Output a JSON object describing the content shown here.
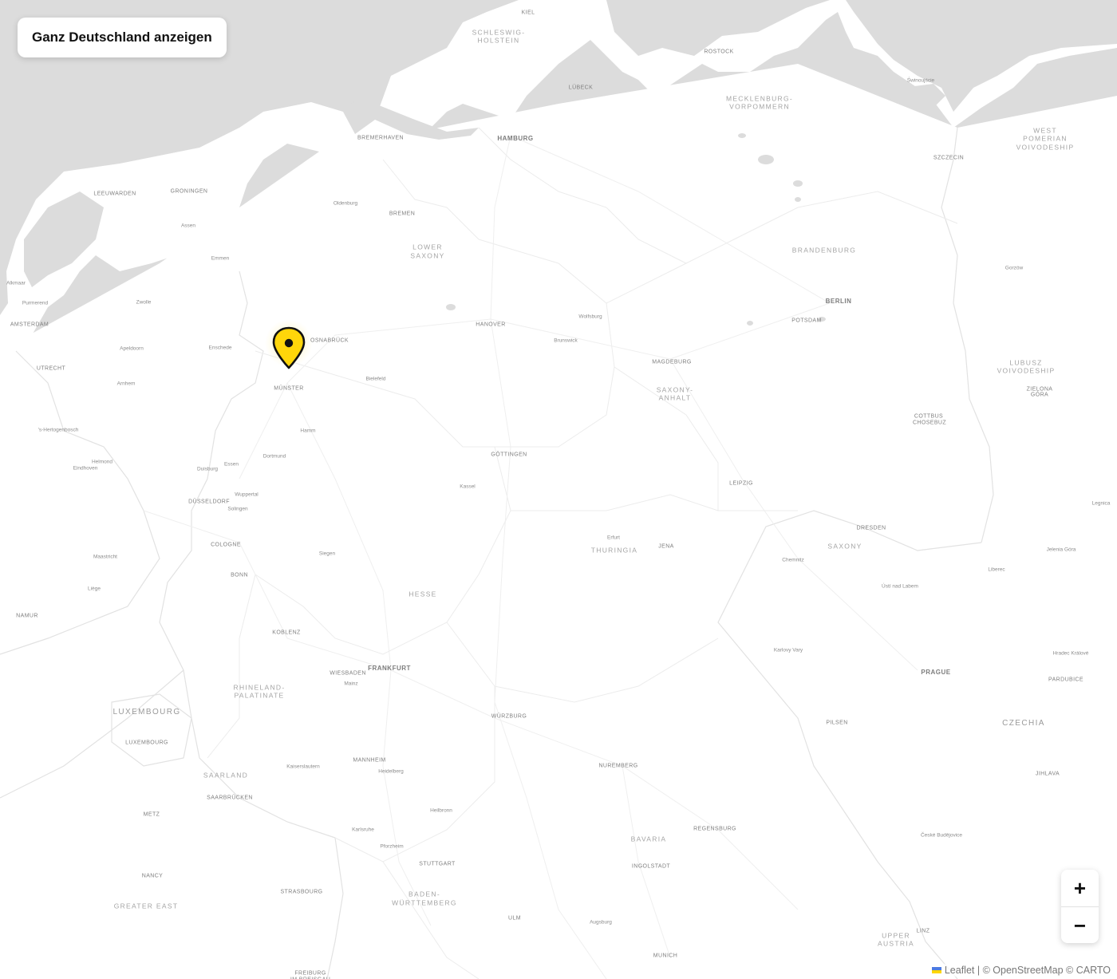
{
  "controls": {
    "reset_label": "Ganz Deutschland anzeigen",
    "zoom_in": "+",
    "zoom_out": "−"
  },
  "attribution": {
    "leaflet": "Leaflet",
    "sep": "|",
    "osm": "© OpenStreetMap",
    "carto": "© CARTO"
  },
  "marker": {
    "color": "#FFD60A",
    "outline": "#111111"
  },
  "colors": {
    "land": "#ffffff",
    "water": "#d9d9d9",
    "border": "#e4e4e4"
  },
  "labels": [
    {
      "t": "KIEL",
      "c": "city"
    },
    {
      "t": "SCHLESWIG-",
      "c": "region"
    },
    {
      "t": "HOLSTEIN",
      "c": "region"
    },
    {
      "t": "ROSTOCK",
      "c": "city"
    },
    {
      "t": "LÜBECK",
      "c": "city"
    },
    {
      "t": "MECKLENBURG-",
      "c": "region"
    },
    {
      "t": "VORPOMMERN",
      "c": "region"
    },
    {
      "t": "Świnoujście",
      "c": "town"
    },
    {
      "t": "WEST",
      "c": "region"
    },
    {
      "t": "POMERIAN",
      "c": "region"
    },
    {
      "t": "VOIVODESHIP",
      "c": "region"
    },
    {
      "t": "SZCZECIN",
      "c": "city"
    },
    {
      "t": "BREMERHAVEN",
      "c": "city"
    },
    {
      "t": "HAMBURG",
      "c": "major"
    },
    {
      "t": "LEEUWARDEN",
      "c": "city"
    },
    {
      "t": "GRONINGEN",
      "c": "city"
    },
    {
      "t": "Oldenburg",
      "c": "town"
    },
    {
      "t": "BREMEN",
      "c": "city"
    },
    {
      "t": "Assen",
      "c": "town"
    },
    {
      "t": "LOWER",
      "c": "region"
    },
    {
      "t": "SAXONY",
      "c": "region"
    },
    {
      "t": "BRANDENBURG",
      "c": "region"
    },
    {
      "t": "Emmen",
      "c": "town"
    },
    {
      "t": "Gorzów",
      "c": "town"
    },
    {
      "t": "Alkmaar",
      "c": "town"
    },
    {
      "t": "Purmerend",
      "c": "town"
    },
    {
      "t": "Zwolle",
      "c": "town"
    },
    {
      "t": "BERLIN",
      "c": "major"
    },
    {
      "t": "Wolfsburg",
      "c": "town"
    },
    {
      "t": "AMSTERDAM",
      "c": "city"
    },
    {
      "t": "HANOVER",
      "c": "city"
    },
    {
      "t": "POTSDAM",
      "c": "city"
    },
    {
      "t": "OSNABRÜCK",
      "c": "city"
    },
    {
      "t": "Enschede",
      "c": "town"
    },
    {
      "t": "Apeldoorn",
      "c": "town"
    },
    {
      "t": "Brunswick",
      "c": "town"
    },
    {
      "t": "MAGDEBURG",
      "c": "city"
    },
    {
      "t": "LUBUSZ",
      "c": "region"
    },
    {
      "t": "VOIVODESHIP",
      "c": "region"
    },
    {
      "t": "UTRECHT",
      "c": "city"
    },
    {
      "t": "Bielefeld",
      "c": "town"
    },
    {
      "t": "Arnhem",
      "c": "town"
    },
    {
      "t": "MÜNSTER",
      "c": "city"
    },
    {
      "t": "SAXONY-",
      "c": "region"
    },
    {
      "t": "ANHALT",
      "c": "region"
    },
    {
      "t": "ZIELONA",
      "c": "city"
    },
    {
      "t": "GÓRA",
      "c": "city"
    },
    {
      "t": "COTTBUS",
      "c": "city"
    },
    {
      "t": "CHOSEBUZ",
      "c": "city"
    },
    {
      "t": "'s-Hertogenbosch",
      "c": "town"
    },
    {
      "t": "Hamm",
      "c": "town"
    },
    {
      "t": "GÖTTINGEN",
      "c": "city"
    },
    {
      "t": "Dortmund",
      "c": "town"
    },
    {
      "t": "Helmond",
      "c": "town"
    },
    {
      "t": "Eindhoven",
      "c": "town"
    },
    {
      "t": "Essen",
      "c": "town"
    },
    {
      "t": "Duisburg",
      "c": "town"
    },
    {
      "t": "Kassel",
      "c": "town"
    },
    {
      "t": "LEIPZIG",
      "c": "city"
    },
    {
      "t": "Wuppertal",
      "c": "town"
    },
    {
      "t": "DÜSSELDORF",
      "c": "city"
    },
    {
      "t": "Solingen",
      "c": "town"
    },
    {
      "t": "Legnica",
      "c": "town"
    },
    {
      "t": "DRESDEN",
      "c": "city"
    },
    {
      "t": "Erfurt",
      "c": "town"
    },
    {
      "t": "COLOGNE",
      "c": "city"
    },
    {
      "t": "THURINGIA",
      "c": "region"
    },
    {
      "t": "JENA",
      "c": "city"
    },
    {
      "t": "SAXONY",
      "c": "region"
    },
    {
      "t": "Siegen",
      "c": "town"
    },
    {
      "t": "Jelenia Góra",
      "c": "town"
    },
    {
      "t": "Maastricht",
      "c": "town"
    },
    {
      "t": "Chemnitz",
      "c": "town"
    },
    {
      "t": "BONN",
      "c": "city"
    },
    {
      "t": "Liberec",
      "c": "town"
    },
    {
      "t": "Liège",
      "c": "town"
    },
    {
      "t": "Ústí nad Labem",
      "c": "town"
    },
    {
      "t": "HESSE",
      "c": "region"
    },
    {
      "t": "NAMUR",
      "c": "city"
    },
    {
      "t": "KOBLENZ",
      "c": "city"
    },
    {
      "t": "Karlovy Vary",
      "c": "town"
    },
    {
      "t": "Hradec Králové",
      "c": "town"
    },
    {
      "t": "FRANKFURT",
      "c": "major"
    },
    {
      "t": "WIESBADEN",
      "c": "city"
    },
    {
      "t": "PRAGUE",
      "c": "major"
    },
    {
      "t": "Mainz",
      "c": "town"
    },
    {
      "t": "PARDUBICE",
      "c": "city"
    },
    {
      "t": "RHINELAND-",
      "c": "region"
    },
    {
      "t": "PALATINATE",
      "c": "region"
    },
    {
      "t": "LUXEMBOURG",
      "c": "country"
    },
    {
      "t": "WÜRZBURG",
      "c": "city"
    },
    {
      "t": "PILSEN",
      "c": "city"
    },
    {
      "t": "CZECHIA",
      "c": "country"
    },
    {
      "t": "LUXEMBOURG",
      "c": "city"
    },
    {
      "t": "MANNHEIM",
      "c": "city"
    },
    {
      "t": "NUREMBERG",
      "c": "city"
    },
    {
      "t": "Kaiserslautern",
      "c": "town"
    },
    {
      "t": "Heidelberg",
      "c": "town"
    },
    {
      "t": "SAARLAND",
      "c": "region"
    },
    {
      "t": "JIHLAVA",
      "c": "city"
    },
    {
      "t": "SAARBRÜCKEN",
      "c": "city"
    },
    {
      "t": "Heilbronn",
      "c": "town"
    },
    {
      "t": "METZ",
      "c": "city"
    },
    {
      "t": "Karlsruhe",
      "c": "town"
    },
    {
      "t": "REGENSBURG",
      "c": "city"
    },
    {
      "t": "BAVARIA",
      "c": "region"
    },
    {
      "t": "České Budějovice",
      "c": "town"
    },
    {
      "t": "Pforzheim",
      "c": "town"
    },
    {
      "t": "STUTTGART",
      "c": "city"
    },
    {
      "t": "INGOLSTADT",
      "c": "city"
    },
    {
      "t": "NANCY",
      "c": "city"
    },
    {
      "t": "STRASBOURG",
      "c": "city"
    },
    {
      "t": "BADEN-",
      "c": "region"
    },
    {
      "t": "WÜRTTEMBERG",
      "c": "region"
    },
    {
      "t": "GREATER EAST",
      "c": "region"
    },
    {
      "t": "ULM",
      "c": "city"
    },
    {
      "t": "Augsburg",
      "c": "town"
    },
    {
      "t": "UPPER",
      "c": "region"
    },
    {
      "t": "AUSTRIA",
      "c": "region"
    },
    {
      "t": "LINZ",
      "c": "city"
    },
    {
      "t": "MUNICH",
      "c": "city"
    },
    {
      "t": "FREIBURG",
      "c": "city"
    },
    {
      "t": "IM BREISGAU",
      "c": "city"
    }
  ]
}
